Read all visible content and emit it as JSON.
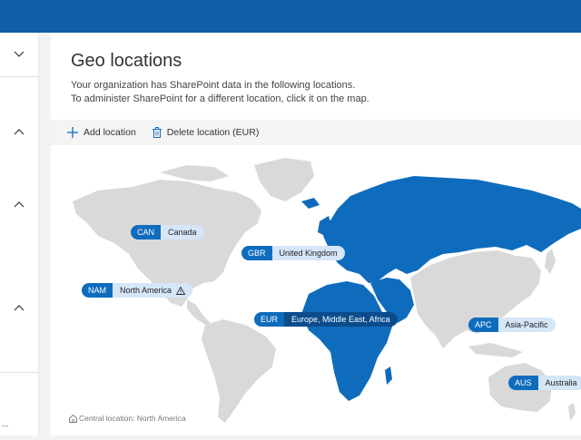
{
  "page": {
    "title": "Geo locations",
    "description_line1": "Your organization has SharePoint data in the following locations.",
    "description_line2": "To administer SharePoint for a different location, click it on the map."
  },
  "toolbar": {
    "add_label": "Add location",
    "delete_label": "Delete location (EUR)"
  },
  "sidebar": {
    "more_label": "..."
  },
  "locations": [
    {
      "code": "CAN",
      "name": "Canada"
    },
    {
      "code": "GBR",
      "name": "United Kingdom"
    },
    {
      "code": "NAM",
      "name": "North America"
    },
    {
      "code": "EUR",
      "name": "Europe, Middle East, Africa"
    },
    {
      "code": "APC",
      "name": "Asia-Pacific"
    },
    {
      "code": "AUS",
      "name": "Australia"
    }
  ],
  "footer": {
    "central_location": "Central location: North America"
  },
  "colors": {
    "accent": "#0f6cbd",
    "topbar": "#0f5ea8",
    "land_selected": "#0f6cbd",
    "land_unselected": "#d9d9d9",
    "label_bg": "#d5e6f7"
  },
  "icons": {
    "add": "plus-icon",
    "delete": "trash-icon",
    "warning": "warning-icon",
    "central": "home-building-icon"
  }
}
